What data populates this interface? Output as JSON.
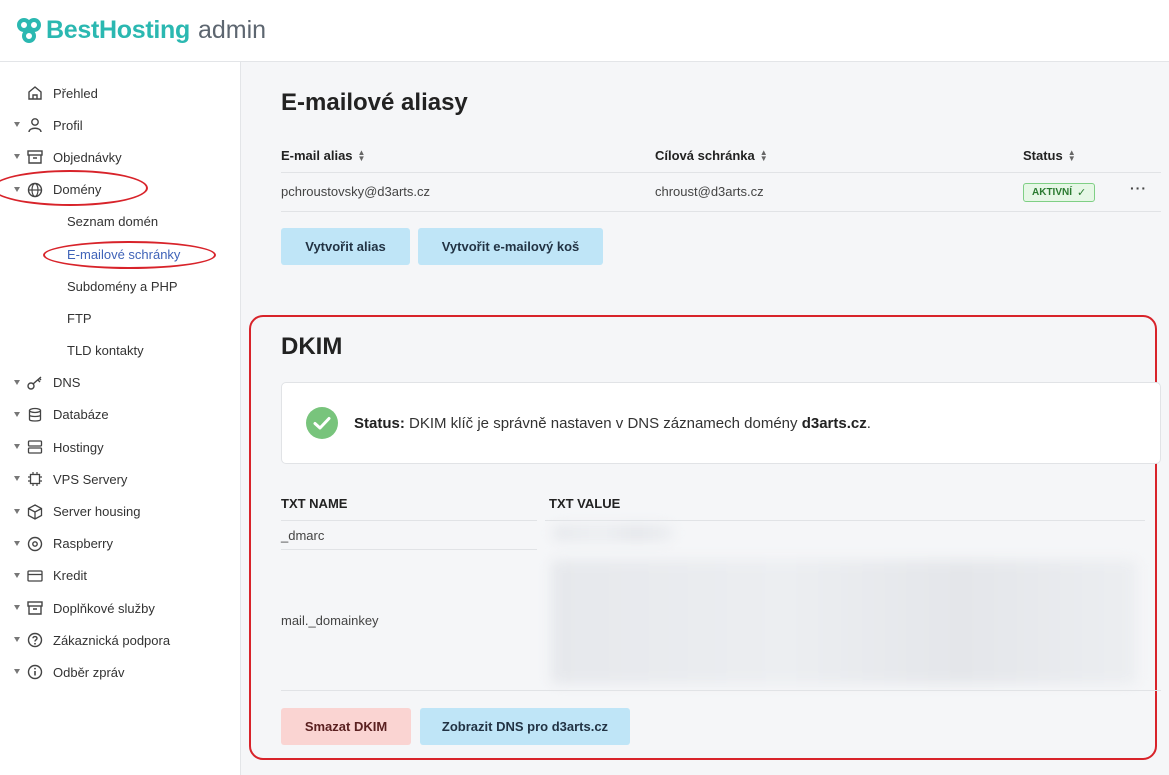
{
  "header": {
    "brand": "BestHosting",
    "suffix": "admin"
  },
  "sidebar": {
    "items": [
      {
        "label": "Přehled",
        "icon": "home-icon",
        "caret": false
      },
      {
        "label": "Profil",
        "icon": "user-icon",
        "caret": true
      },
      {
        "label": "Objednávky",
        "icon": "archive-icon",
        "caret": true
      },
      {
        "label": "Domény",
        "icon": "globe-icon",
        "caret": true
      },
      {
        "label": "Seznam domén",
        "sub": true
      },
      {
        "label": "E-mailové schránky",
        "sub": true,
        "active": true
      },
      {
        "label": "Subdomény a PHP",
        "sub": true
      },
      {
        "label": "FTP",
        "sub": true
      },
      {
        "label": "TLD kontakty",
        "sub": true
      },
      {
        "label": "DNS",
        "icon": "key-icon",
        "caret": true
      },
      {
        "label": "Databáze",
        "icon": "database-icon",
        "caret": true
      },
      {
        "label": "Hostingy",
        "icon": "server-icon",
        "caret": true
      },
      {
        "label": "VPS Servery",
        "icon": "chip-icon",
        "caret": true
      },
      {
        "label": "Server housing",
        "icon": "box-icon",
        "caret": true
      },
      {
        "label": "Raspberry",
        "icon": "disc-icon",
        "caret": true
      },
      {
        "label": "Kredit",
        "icon": "card-icon",
        "caret": true
      },
      {
        "label": "Doplňkové služby",
        "icon": "archive-icon",
        "caret": true
      },
      {
        "label": "Zákaznická podpora",
        "icon": "help-icon",
        "caret": true
      },
      {
        "label": "Odběr zpráv",
        "icon": "info-icon",
        "caret": true
      }
    ]
  },
  "aliases": {
    "title": "E-mailové aliasy",
    "columns": [
      "E-mail alias",
      "Cílová schránka",
      "Status"
    ],
    "rows": [
      {
        "alias": "pchroustovsky@d3arts.cz",
        "target": "chroust@d3arts.cz",
        "status": "AKTIVNÍ"
      }
    ],
    "more": "···",
    "create_alias": "Vytvořit alias",
    "create_trash": "Vytvořit e-mailový koš"
  },
  "dkim": {
    "title": "DKIM",
    "status_label": "Status:",
    "status_text": "DKIM klíč je správně nastaven v DNS záznamech domény",
    "status_domain": "d3arts.cz",
    "status_end": ".",
    "columns": [
      "TXT NAME",
      "TXT VALUE"
    ],
    "rows": [
      {
        "name": "_dmarc"
      },
      {
        "name": "mail._domainkey"
      }
    ],
    "delete": "Smazat DKIM",
    "show_dns": "Zobrazit DNS pro d3arts.cz"
  },
  "colors": {
    "brand": "#2bb8b1",
    "accent": "#3f63b8",
    "highlight": "#d8232a",
    "success": "#78c47c"
  }
}
